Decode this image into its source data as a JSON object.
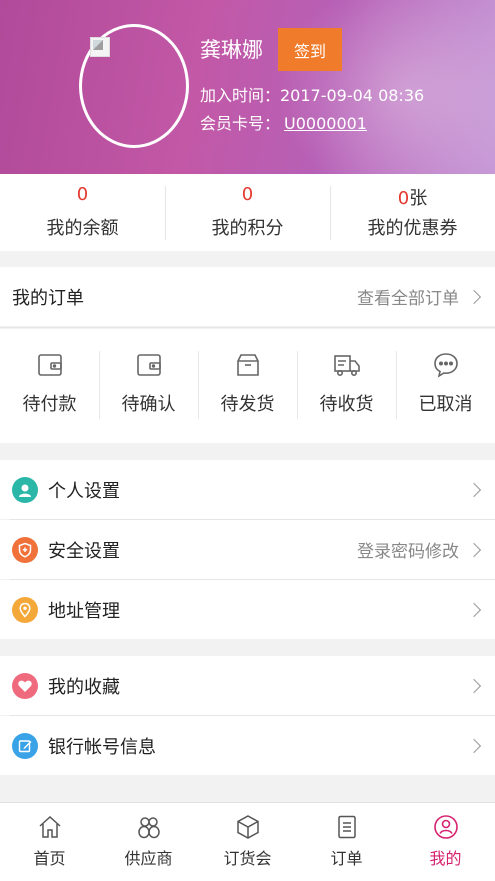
{
  "profile": {
    "name": "龚琳娜",
    "signin_label": "签到",
    "join_time": "加入时间：2017-09-04 08:36",
    "card_label": "会员卡号：",
    "card_number": "U0000001"
  },
  "stats": [
    {
      "value": "0",
      "unit": "",
      "label": "我的余额"
    },
    {
      "value": "0",
      "unit": "",
      "label": "我的积分"
    },
    {
      "value": "0",
      "unit": "张",
      "label": "我的优惠券"
    }
  ],
  "orders": {
    "title": "我的订单",
    "view_all": "查看全部订单",
    "statuses": [
      {
        "label": "待付款",
        "icon": "wallet-icon"
      },
      {
        "label": "待确认",
        "icon": "wallet-icon"
      },
      {
        "label": "待发货",
        "icon": "box-icon"
      },
      {
        "label": "待收货",
        "icon": "truck-icon"
      },
      {
        "label": "已取消",
        "icon": "chat-icon"
      }
    ]
  },
  "menu": [
    {
      "label": "个人设置",
      "right": "",
      "icon": "person-icon",
      "color": "#2bb7a8"
    },
    {
      "label": "安全设置",
      "right": "登录密码修改",
      "icon": "shield-icon",
      "color": "#f0713a"
    },
    {
      "label": "地址管理",
      "right": "",
      "icon": "location-icon",
      "color": "#f4a83a"
    },
    {
      "label": "我的收藏",
      "right": "",
      "icon": "heart-icon",
      "color": "#f06a7e"
    },
    {
      "label": "银行帐号信息",
      "right": "",
      "icon": "edit-icon",
      "color": "#3aa3e8"
    }
  ],
  "tabs": [
    {
      "label": "首页",
      "icon": "home-icon"
    },
    {
      "label": "供应商",
      "icon": "supplier-icon"
    },
    {
      "label": "订货会",
      "icon": "cube-icon"
    },
    {
      "label": "订单",
      "icon": "list-icon"
    },
    {
      "label": "我的",
      "icon": "user-icon",
      "active": true
    }
  ],
  "accent_color": "#d6226f"
}
